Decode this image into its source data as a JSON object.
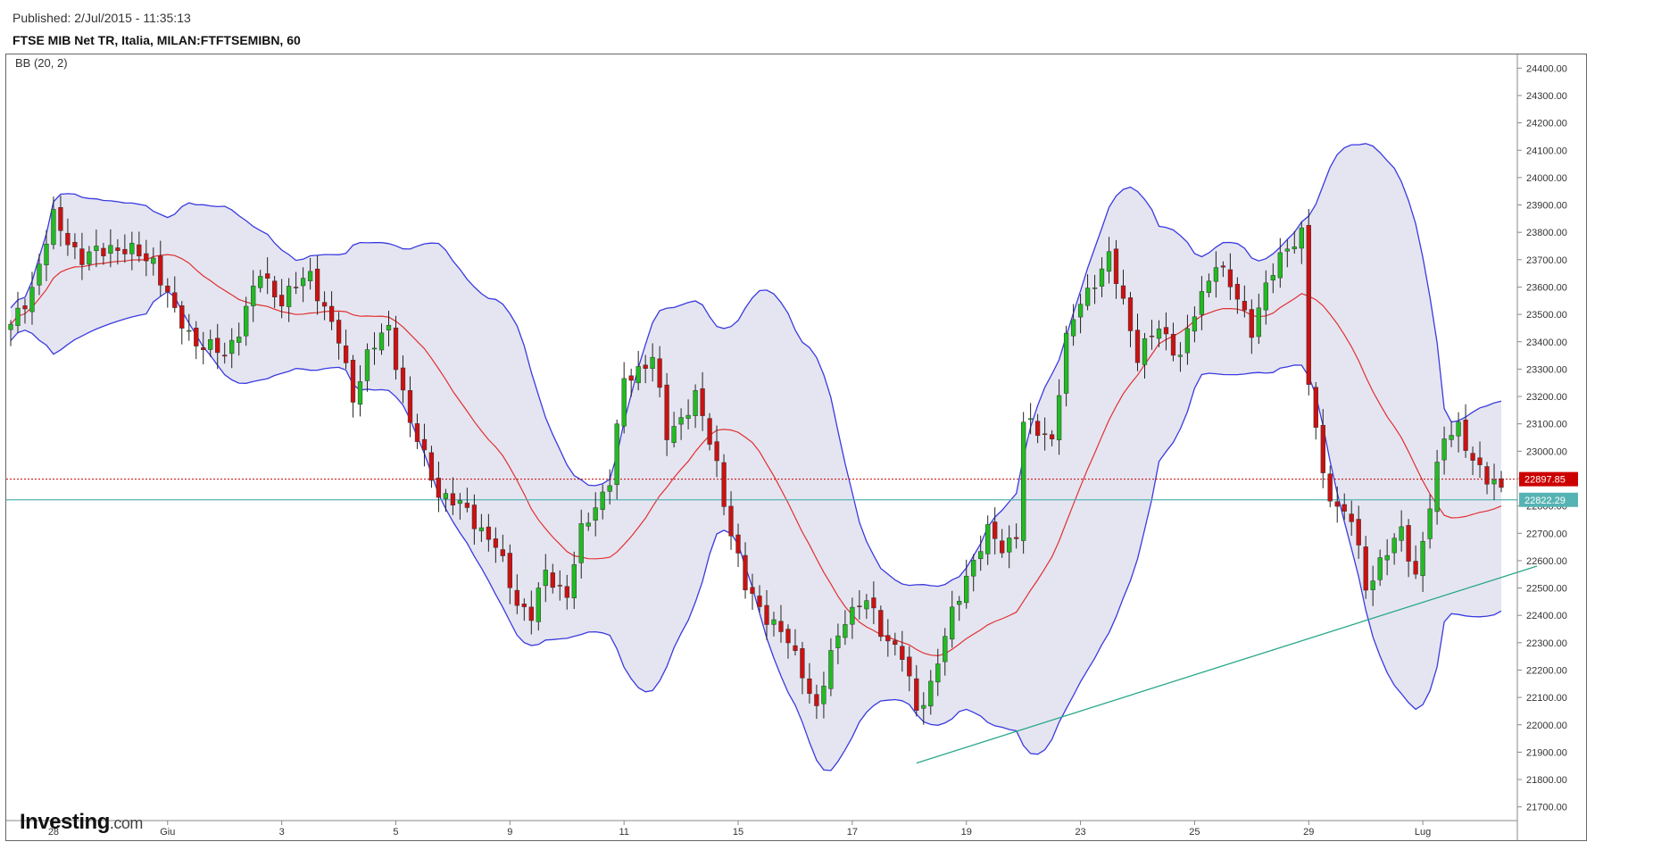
{
  "header": {
    "published": "Published: 2/Jul/2015 - 11:35:13",
    "title": "FTSE MIB Net TR, Italia, MILAN:FTFTSEMIBN, 60"
  },
  "logo": {
    "main": "Investing",
    "suffix": ".com"
  },
  "colors": {
    "bull": "#22bb22",
    "bear": "#cc1111",
    "band_line": "#3a3ae0",
    "band_fill": "#dcdcec",
    "basis": "#e03030",
    "last_price": "#cc0000",
    "ref_line": "#56b3b3",
    "trend": "#2aa88a"
  },
  "chart_data": {
    "type": "candlestick",
    "indicator": "BB (20, 2)",
    "ylim": [
      21650,
      24450
    ],
    "y_ticks": [
      21700,
      21800,
      21900,
      22000,
      22100,
      22200,
      22300,
      22400,
      22500,
      22600,
      22700,
      22800,
      22900,
      23000,
      23100,
      23200,
      23300,
      23400,
      23500,
      23600,
      23700,
      23800,
      23900,
      24000,
      24100,
      24200,
      24300,
      24400
    ],
    "x_labels": [
      {
        "label": "28",
        "bar": 6
      },
      {
        "label": "Giu",
        "bar": 22
      },
      {
        "label": "3",
        "bar": 38
      },
      {
        "label": "5",
        "bar": 54
      },
      {
        "label": "9",
        "bar": 70
      },
      {
        "label": "11",
        "bar": 86
      },
      {
        "label": "15",
        "bar": 102
      },
      {
        "label": "17",
        "bar": 118
      },
      {
        "label": "19",
        "bar": 134
      },
      {
        "label": "23",
        "bar": 150
      },
      {
        "label": "25",
        "bar": 166
      },
      {
        "label": "29",
        "bar": 182
      },
      {
        "label": "Lug",
        "bar": 198
      }
    ],
    "last_price": {
      "value": 22897.85,
      "label": "22897.85"
    },
    "ref_level": {
      "value": 22822.29,
      "label": "22822.29"
    },
    "trendline": {
      "from": {
        "bar": 127,
        "price": 21860
      },
      "to": {
        "bar": 214,
        "price": 22580
      }
    },
    "price_path": [
      [
        0,
        23450
      ],
      [
        3,
        23600
      ],
      [
        6,
        23850
      ],
      [
        10,
        23700
      ],
      [
        14,
        23750
      ],
      [
        20,
        23700
      ],
      [
        23,
        23500
      ],
      [
        26,
        23400
      ],
      [
        30,
        23350
      ],
      [
        32,
        23450
      ],
      [
        35,
        23650
      ],
      [
        38,
        23550
      ],
      [
        42,
        23650
      ],
      [
        44,
        23520
      ],
      [
        46,
        23400
      ],
      [
        48,
        23200
      ],
      [
        50,
        23350
      ],
      [
        53,
        23450
      ],
      [
        56,
        23100
      ],
      [
        60,
        22850
      ],
      [
        64,
        22780
      ],
      [
        68,
        22650
      ],
      [
        71,
        22450
      ],
      [
        73,
        22400
      ],
      [
        75,
        22550
      ],
      [
        78,
        22480
      ],
      [
        80,
        22700
      ],
      [
        84,
        22900
      ],
      [
        86,
        23250
      ],
      [
        90,
        23350
      ],
      [
        92,
        23050
      ],
      [
        96,
        23200
      ],
      [
        99,
        22950
      ],
      [
        101,
        22700
      ],
      [
        103,
        22500
      ],
      [
        106,
        22400
      ],
      [
        109,
        22300
      ],
      [
        111,
        22200
      ],
      [
        113,
        22050
      ],
      [
        115,
        22250
      ],
      [
        117,
        22400
      ],
      [
        120,
        22450
      ],
      [
        122,
        22350
      ],
      [
        125,
        22250
      ],
      [
        127,
        22050
      ],
      [
        129,
        22150
      ],
      [
        132,
        22400
      ],
      [
        134,
        22550
      ],
      [
        137,
        22700
      ],
      [
        139,
        22650
      ],
      [
        141,
        22700
      ],
      [
        142,
        23100
      ],
      [
        146,
        23050
      ],
      [
        148,
        23400
      ],
      [
        150,
        23550
      ],
      [
        154,
        23700
      ],
      [
        156,
        23550
      ],
      [
        158,
        23350
      ],
      [
        161,
        23450
      ],
      [
        164,
        23350
      ],
      [
        166,
        23500
      ],
      [
        169,
        23700
      ],
      [
        172,
        23550
      ],
      [
        174,
        23450
      ],
      [
        176,
        23600
      ],
      [
        179,
        23750
      ],
      [
        181,
        23800
      ],
      [
        182,
        23250
      ],
      [
        184,
        22900
      ],
      [
        186,
        22800
      ],
      [
        188,
        22750
      ],
      [
        190,
        22500
      ],
      [
        192,
        22600
      ],
      [
        195,
        22700
      ],
      [
        197,
        22550
      ],
      [
        199,
        22800
      ],
      [
        201,
        23050
      ],
      [
        203,
        23100
      ],
      [
        205,
        22950
      ],
      [
        207,
        22900
      ],
      [
        209,
        22880
      ]
    ],
    "bar_count": 210
  }
}
